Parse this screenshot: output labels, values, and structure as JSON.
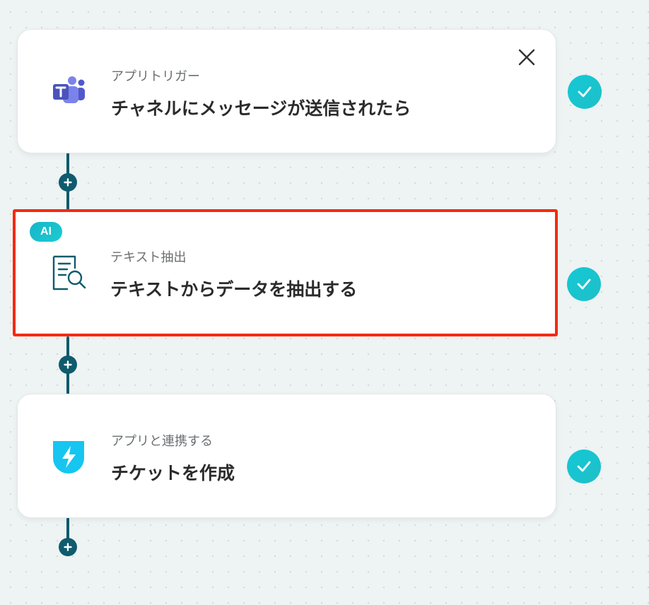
{
  "flow": {
    "steps": [
      {
        "category": "アプリトリガー",
        "title": "チャネルにメッセージが送信されたら",
        "icon": "teams-icon",
        "status": "completed"
      },
      {
        "badge": "AI",
        "category": "テキスト抽出",
        "title": "テキストからデータを抽出する",
        "icon": "document-search-icon",
        "status": "completed",
        "highlighted": true
      },
      {
        "category": "アプリと連携する",
        "title": "チケットを作成",
        "icon": "bolt-app-icon",
        "status": "completed"
      }
    ]
  },
  "colors": {
    "connector": "#0f5b6e",
    "check": "#1cc6d2",
    "highlight_border": "#f52a10",
    "ai_badge": "#16b6c9"
  }
}
